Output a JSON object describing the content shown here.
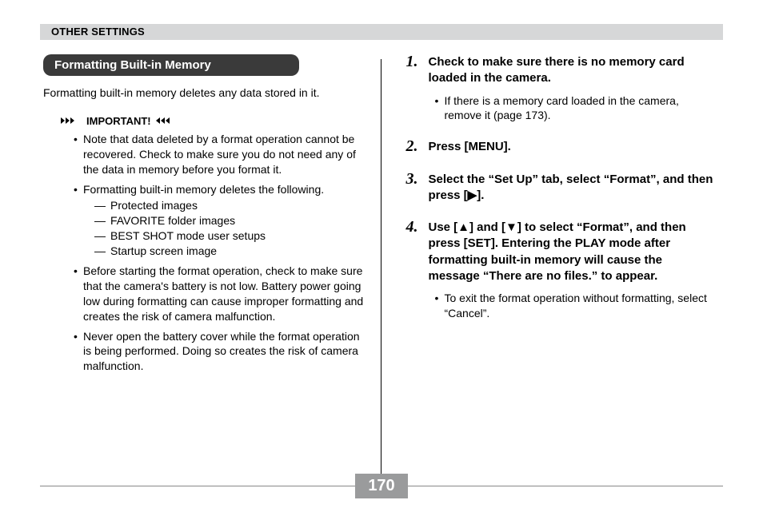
{
  "header": {
    "title": "OTHER SETTINGS"
  },
  "section": {
    "heading": "Formatting Built-in Memory",
    "intro": "Formatting built-in memory deletes any data stored in it."
  },
  "important": {
    "label": "IMPORTANT!",
    "bullets": [
      "Note that data deleted by a format operation cannot be recovered. Check to make sure you do not need any of the data in memory before you format it.",
      "Formatting built-in memory deletes the following.",
      "Before starting the format operation, check to make sure that the camera's battery is not low. Battery power going low during formatting can cause improper formatting and creates the risk of camera malfunction.",
      "Never open the battery cover while the format operation is being performed. Doing so creates the risk of camera malfunction."
    ],
    "deletes": [
      "Protected images",
      "FAVORITE folder images",
      "BEST SHOT mode user setups",
      "Startup screen image"
    ]
  },
  "steps": [
    {
      "num": "1.",
      "head": "Check to make sure there is no memory card loaded in the camera.",
      "sub": [
        "If there is a memory card loaded in the camera, remove it (page 173)."
      ]
    },
    {
      "num": "2.",
      "head": "Press [MENU].",
      "sub": []
    },
    {
      "num": "3.",
      "head": "Select the “Set Up” tab, select “Format”, and then press [▶].",
      "sub": []
    },
    {
      "num": "4.",
      "head": "Use [▲] and [▼] to select “Format”, and then press [SET]. Entering the PLAY mode after formatting built-in memory will cause the message “There are no files.” to appear.",
      "sub": [
        "To exit the format operation without formatting, select “Cancel”."
      ]
    }
  ],
  "page_number": "170"
}
